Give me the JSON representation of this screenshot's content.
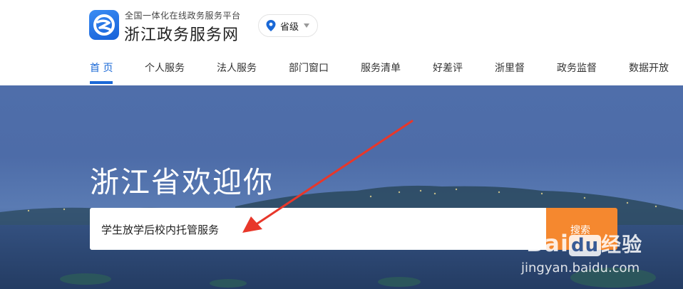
{
  "header": {
    "slogan": "全国一体化在线政务服务平台",
    "site_name": "浙江政务服务网",
    "logo_icon": "zhejiang-gov-logo-icon",
    "region_selector": {
      "label": "省级",
      "icon": "location-pin-icon"
    }
  },
  "nav": {
    "active_color": "#1a68d6",
    "items": [
      {
        "label": "首 页",
        "active": true
      },
      {
        "label": "个人服务"
      },
      {
        "label": "法人服务"
      },
      {
        "label": "部门窗口"
      },
      {
        "label": "服务清单"
      },
      {
        "label": "好差评"
      },
      {
        "label": "浙里督"
      },
      {
        "label": "政务监督"
      },
      {
        "label": "数据开放"
      }
    ]
  },
  "hero": {
    "welcome": "浙江省欢迎你",
    "search": {
      "value": "学生放学后校内托管服务",
      "button_label": "搜索",
      "button_color": "#f5882f"
    }
  },
  "watermark": {
    "brand": "Bai",
    "brand_box": "du",
    "brand_suffix": "经验",
    "url": "jingyan.baidu.com"
  },
  "annotation": {
    "arrow_color": "#e8372a"
  }
}
